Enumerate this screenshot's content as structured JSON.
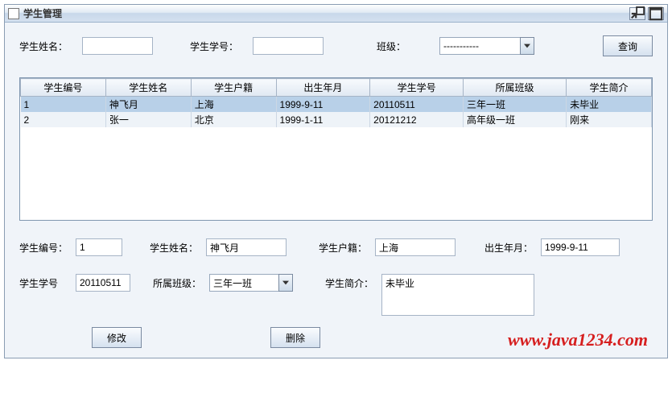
{
  "window": {
    "title": "学生管理"
  },
  "filter": {
    "nameLabel": "学生姓名：",
    "nameValue": "",
    "idLabel": "学生学号：",
    "idValue": "",
    "classLabel": "班级：",
    "classSelected": "-----------",
    "searchBtn": "查询"
  },
  "table": {
    "headers": [
      "学生编号",
      "学生姓名",
      "学生户籍",
      "出生年月",
      "学生学号",
      "所属班级",
      "学生简介"
    ],
    "rows": [
      {
        "cells": [
          "1",
          "神飞月",
          "上海",
          "1999-9-11",
          "20110511",
          "三年一班",
          "未毕业"
        ],
        "selected": true
      },
      {
        "cells": [
          "2",
          "张一",
          "北京",
          "1999-1-11",
          "20121212",
          "高年级一班",
          "刚来"
        ],
        "selected": false
      }
    ]
  },
  "detail": {
    "noLabel": "学生编号：",
    "noValue": "1",
    "nameLabel": "学生姓名：",
    "nameValue": "神飞月",
    "originLabel": "学生户籍：",
    "originValue": "上海",
    "dobLabel": "出生年月：",
    "dobValue": "1999-9-11",
    "sidLabel": "学生学号",
    "sidValue": "20110511",
    "classLabel": "所属班级：",
    "classValue": "三年一班",
    "introLabel": "学生简介：",
    "introValue": "未毕业"
  },
  "actions": {
    "modify": "修改",
    "delete": "删除"
  },
  "watermark": "www.java1234.com"
}
